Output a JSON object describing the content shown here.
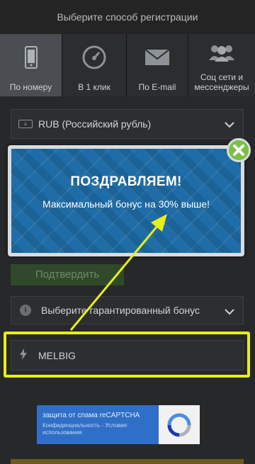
{
  "header": {
    "title": "Выберите способ регистрации"
  },
  "tabs": [
    {
      "label": "По номеру",
      "icon": "phone-icon",
      "active": true
    },
    {
      "label": "В 1 клик",
      "icon": "speedometer-icon",
      "active": false
    },
    {
      "label": "По E-mail",
      "icon": "envelope-icon",
      "active": false
    },
    {
      "label": "Соц сети и мессенджеры",
      "icon": "users-icon",
      "active": false
    }
  ],
  "form": {
    "currency": {
      "value": "RUB (Российский рубль)",
      "icon": "money-icon"
    },
    "confirm_label": "Подтвердить",
    "bonus": {
      "placeholder": "Выберите гарантированный бонус",
      "icon": "info-icon"
    },
    "promo": {
      "value": "MELBIG",
      "icon": "bolt-icon"
    },
    "captcha": {
      "title": "защита от спама reCAPTCHA",
      "subtitle": "Конфиденциальность - Условия использования",
      "icon": "recaptcha-icon"
    }
  },
  "popup": {
    "title": "ПОЗДРАВЛЯЕМ!",
    "subtitle": "Максимальный бонус на 30% выше!",
    "close_icon": "close-icon"
  },
  "colors": {
    "accent_green": "#7ac142",
    "highlight_yellow": "#e6ef1a",
    "popup_blue": "#1e6da8",
    "active_tab": "#4a4e52"
  }
}
